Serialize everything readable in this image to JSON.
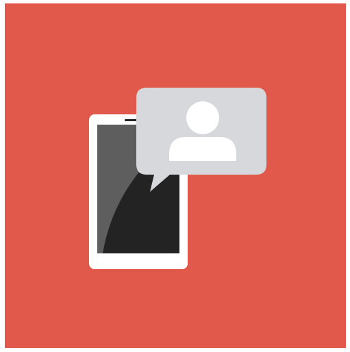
{
  "illustration": {
    "subject": "phone-with-contact-message-bubble",
    "icons": [
      "smartphone-icon",
      "chat-bubble-icon",
      "user-avatar-icon"
    ],
    "colors": {
      "background": "#E0594A",
      "phone_body": "#FFFFFF",
      "screen_dark": "#232323",
      "screen_glare": "#5E5E5E",
      "bubble": "#D7D8DC",
      "avatar": "#FFFFFF"
    }
  }
}
